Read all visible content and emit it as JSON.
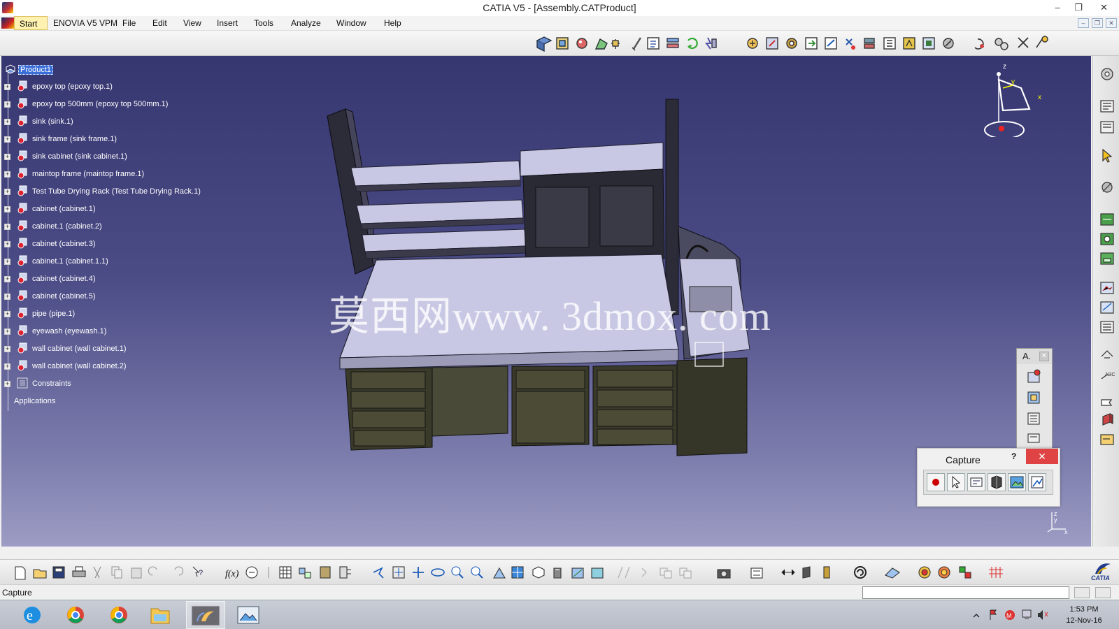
{
  "window": {
    "title": "CATIA V5 - [Assembly.CATProduct]",
    "min_glyph": "–",
    "max_glyph": "❐",
    "close_glyph": "✕"
  },
  "menu": {
    "start": "Start",
    "items": [
      "ENOVIA V5 VPM",
      "File",
      "Edit",
      "View",
      "Insert",
      "Tools",
      "Analyze",
      "Window",
      "Help"
    ]
  },
  "tree": {
    "root": "Product1",
    "items": [
      "epoxy top (epoxy top.1)",
      "epoxy top 500mm (epoxy top 500mm.1)",
      "sink (sink.1)",
      "sink frame (sink frame.1)",
      "sink cabinet (sink cabinet.1)",
      "maintop frame (maintop frame.1)",
      "Test Tube Drying Rack (Test Tube Drying Rack.1)",
      "cabinet (cabinet.1)",
      "cabinet.1 (cabinet.2)",
      "cabinet (cabinet.3)",
      "cabinet.1 (cabinet.1.1)",
      "cabinet (cabinet.4)",
      "cabinet (cabinet.5)",
      "pipe (pipe.1)",
      "eyewash (eyewash.1)",
      "wall cabinet (wall cabinet.1)",
      "wall cabinet (wall cabinet.2)"
    ],
    "constraints": "Constraints",
    "applications": "Applications"
  },
  "viewport": {
    "watermark": "莫西网www. 3dmox. com",
    "compass_x": "x",
    "compass_y": "y",
    "compass_z": "z"
  },
  "floating_toolbar": {
    "title": "A."
  },
  "capture_dialog": {
    "title": "Capture",
    "help": "?",
    "close": "✕"
  },
  "status": {
    "text": "Capture",
    "command_value": ""
  },
  "taskbar": {
    "time": "1:53 PM",
    "date": "12-Nov-16"
  },
  "brand": {
    "catia_logo": "CATIA"
  },
  "colors": {
    "viewport_top": "#363670",
    "viewport_bottom": "#9c9cc4",
    "selection": "#3b6fd8",
    "start_highlight": "#fff2b0",
    "close_red": "#e04343"
  }
}
